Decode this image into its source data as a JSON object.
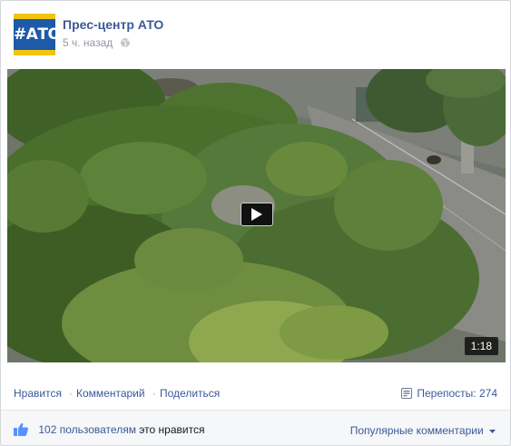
{
  "post": {
    "page_name": "Прес-центр АТО",
    "avatar_text": "#АТО",
    "timestamp": "5 ч. назад",
    "privacy_icon": "globe-icon"
  },
  "video": {
    "duration": "1:18",
    "play_icon": "play-icon"
  },
  "actions": {
    "like": "Нравится",
    "separator": "·",
    "comment": "Комментарий",
    "share": "Поделиться",
    "shares_label": "Перепосты: 274",
    "shares_icon": "share-icon"
  },
  "footer": {
    "like_icon": "thumbs-up-icon",
    "likes_count": "102 пользователям",
    "likes_suffix": "это нравится",
    "sort_label": "Популярные комментарии"
  },
  "colors": {
    "link": "#3b5998",
    "muted": "#9197a3",
    "avatar_blue": "#1d5aa8",
    "avatar_yellow": "#f2c40f"
  }
}
